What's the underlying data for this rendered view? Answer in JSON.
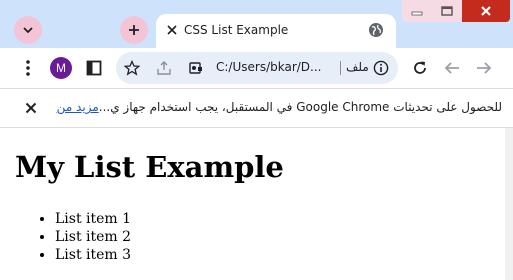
{
  "tab": {
    "title": "CSS List Example"
  },
  "toolbar": {
    "profile_initial": "M",
    "url": "C:/Users/bkar/D...",
    "file_label": "ملف"
  },
  "infobar": {
    "message": "للحصول على تحديثات Google Chrome في المستقبل، يجب استخدام جهاز ي...",
    "link": "مزيد من المعلومات"
  },
  "page": {
    "heading": "My List Example",
    "items": [
      "List item 1",
      "List item 2",
      "List item 3"
    ]
  },
  "colors": {
    "titlebar": "#cfe2fb",
    "close_button": "#c42b1c",
    "link": "#1a56c4",
    "profile": "#6a1b9a"
  }
}
